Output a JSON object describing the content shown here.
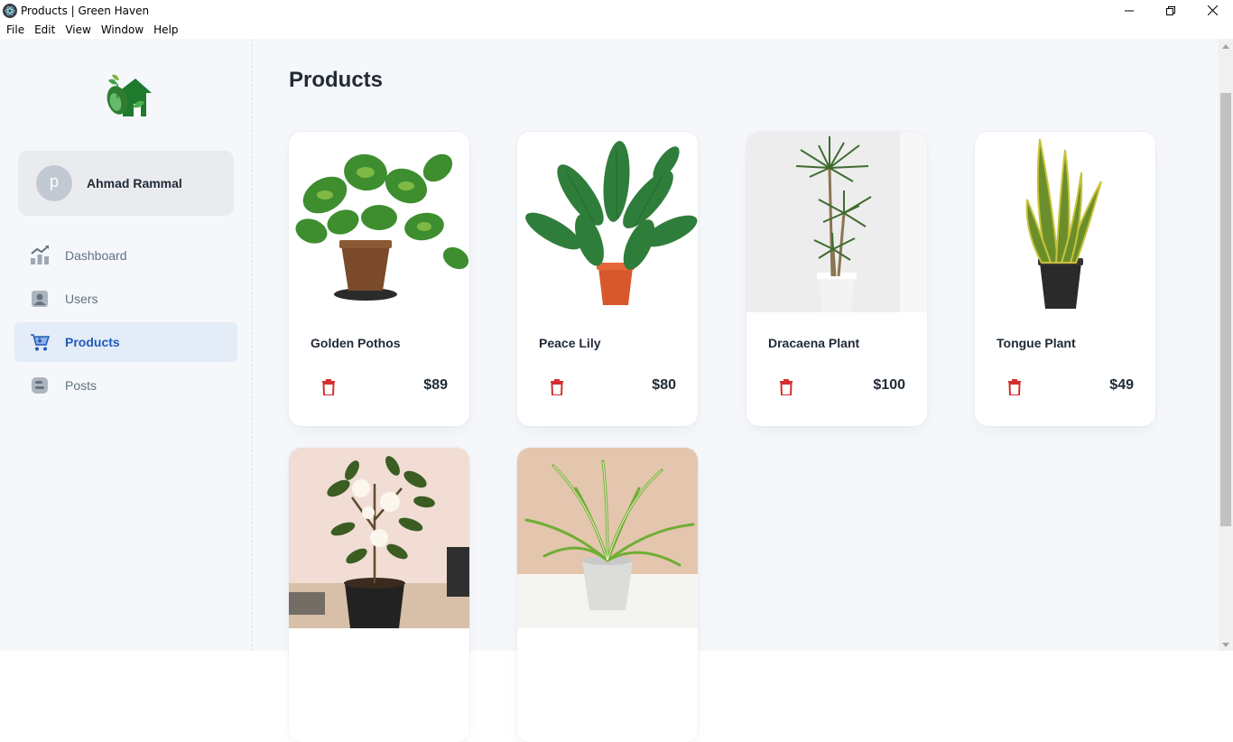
{
  "window": {
    "title": "Products | Green Haven",
    "app_icon": "electron-icon",
    "controls": [
      "minimize-icon",
      "restore-icon",
      "close-icon"
    ]
  },
  "menu": [
    "File",
    "Edit",
    "View",
    "Window",
    "Help"
  ],
  "sidebar": {
    "logo": "green-haven-logo",
    "user": {
      "avatar_letter": "p",
      "name": "Ahmad Rammal"
    },
    "items": [
      {
        "label": "Dashboard",
        "icon": "chart-icon",
        "active": false
      },
      {
        "label": "Users",
        "icon": "user-icon",
        "active": false
      },
      {
        "label": "Products",
        "icon": "cart-icon",
        "active": true
      },
      {
        "label": "Posts",
        "icon": "post-icon",
        "active": false
      }
    ]
  },
  "main": {
    "title": "Products",
    "products": [
      {
        "name": "Golden Pothos",
        "price": "$89"
      },
      {
        "name": "Peace Lily",
        "price": "$80"
      },
      {
        "name": "Dracaena Plant",
        "price": "$100"
      },
      {
        "name": "Tongue Plant",
        "price": "$49"
      },
      {
        "name": "",
        "price": ""
      },
      {
        "name": "",
        "price": ""
      }
    ]
  },
  "colors": {
    "accent": "#1f5bb8",
    "active_bg": "#e4ecf8",
    "delete": "#d32f2f",
    "background": "#f5f7fa"
  }
}
